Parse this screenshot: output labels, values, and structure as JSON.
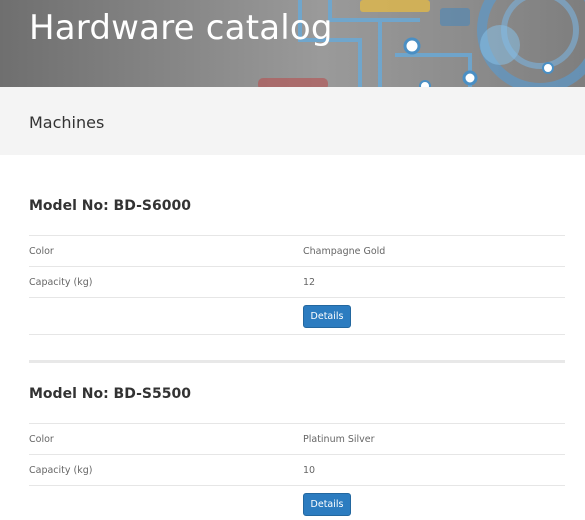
{
  "header": {
    "title": "Hardware catalog"
  },
  "section": {
    "title": "Machines"
  },
  "machines": [
    {
      "title": "Model No: BD-S6000",
      "rows": [
        {
          "label": "Color",
          "value": "Champagne Gold"
        },
        {
          "label": "Capacity (kg)",
          "value": "12"
        }
      ],
      "button_label": "Details"
    },
    {
      "title": "Model No: BD-S5500",
      "rows": [
        {
          "label": "Color",
          "value": "Platinum Silver"
        },
        {
          "label": "Capacity (kg)",
          "value": "10"
        }
      ],
      "button_label": "Details"
    }
  ],
  "colors": {
    "accent": "#2c7cc0",
    "band": "#f4f4f4",
    "hero_art": "#6aa9d6"
  }
}
